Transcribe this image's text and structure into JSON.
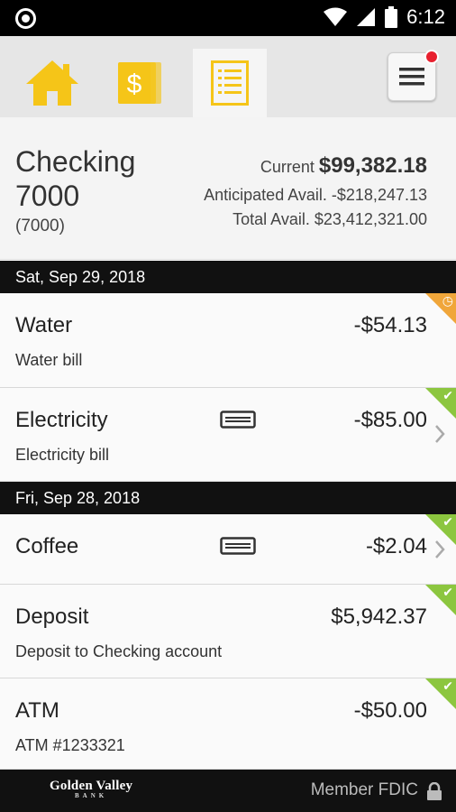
{
  "status_bar": {
    "time": "6:12"
  },
  "tabs": [
    {
      "name": "home",
      "icon": "home-icon"
    },
    {
      "name": "transfer",
      "icon": "money-icon"
    },
    {
      "name": "accounts",
      "icon": "ledger-icon",
      "active": true
    }
  ],
  "menu": {
    "icon": "hamburger-icon",
    "has_notification": true
  },
  "account": {
    "name": "Checking 7000",
    "number": "(7000)",
    "current_label": "Current",
    "current_value": "$99,382.18",
    "anticipated": "Anticipated Avail. -$218,247.13",
    "total": "Total Avail. $23,412,321.00"
  },
  "groups": [
    {
      "date": "Sat, Sep 29, 2018",
      "transactions": [
        {
          "name": "Water",
          "description": "Water bill",
          "amount": "-$54.13",
          "status": "pending"
        },
        {
          "name": "Electricity",
          "description": "Electricity bill",
          "amount": "-$85.00",
          "status": "cleared"
        }
      ]
    },
    {
      "date": "Fri, Sep 28, 2018",
      "transactions": [
        {
          "name": "Coffee",
          "description": "",
          "amount": "-$2.04",
          "status": "cleared"
        },
        {
          "name": "Deposit",
          "description": "Deposit to Checking account",
          "amount": "$5,942.37",
          "status": "cleared"
        },
        {
          "name": "ATM",
          "description": "ATM #1233321",
          "amount": "-$50.00",
          "status": "cleared"
        }
      ]
    }
  ],
  "footer": {
    "logo": "Golden Valley",
    "logo_sub": "BANK",
    "member": "Member FDIC"
  },
  "colors": {
    "accent": "#f5c518",
    "cleared": "#8cc63f",
    "pending": "#f0a63a",
    "notification": "#e8202f"
  }
}
